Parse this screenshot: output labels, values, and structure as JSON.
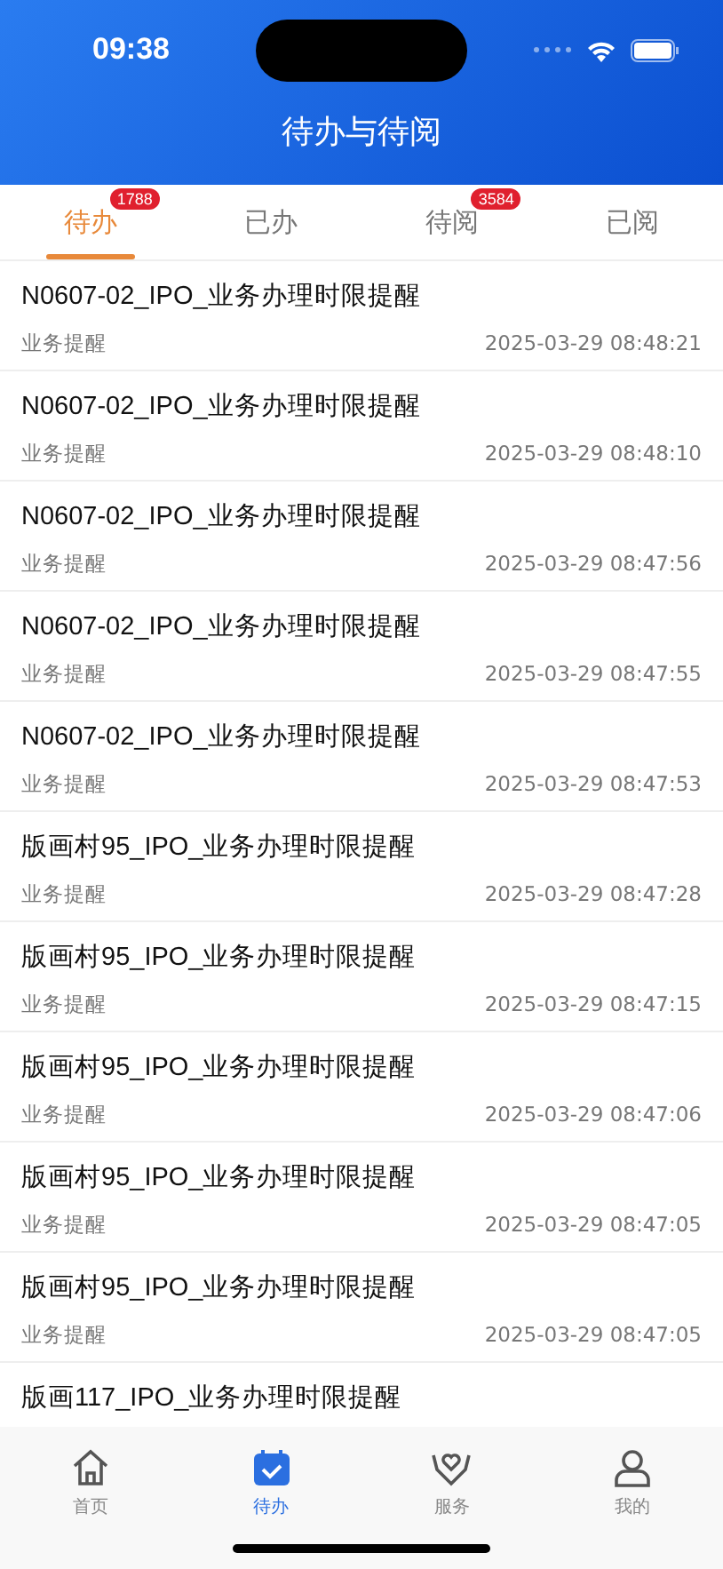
{
  "status_bar": {
    "time": "09:38"
  },
  "header": {
    "title": "待办与待阅"
  },
  "tabs": [
    {
      "label": "待办",
      "selected": true,
      "badge": "1788"
    },
    {
      "label": "已办",
      "selected": false
    },
    {
      "label": "待阅",
      "selected": false,
      "badge": "3584"
    },
    {
      "label": "已阅",
      "selected": false
    }
  ],
  "items": [
    {
      "title": "N0607-02_IPO_业务办理时限提醒",
      "type": "业务提醒",
      "time": "2025-03-29 08:48:21"
    },
    {
      "title": "N0607-02_IPO_业务办理时限提醒",
      "type": "业务提醒",
      "time": "2025-03-29 08:48:10"
    },
    {
      "title": "N0607-02_IPO_业务办理时限提醒",
      "type": "业务提醒",
      "time": "2025-03-29 08:47:56"
    },
    {
      "title": "N0607-02_IPO_业务办理时限提醒",
      "type": "业务提醒",
      "time": "2025-03-29 08:47:55"
    },
    {
      "title": "N0607-02_IPO_业务办理时限提醒",
      "type": "业务提醒",
      "time": "2025-03-29 08:47:53"
    },
    {
      "title": "版画村95_IPO_业务办理时限提醒",
      "type": "业务提醒",
      "time": "2025-03-29 08:47:28"
    },
    {
      "title": "版画村95_IPO_业务办理时限提醒",
      "type": "业务提醒",
      "time": "2025-03-29 08:47:15"
    },
    {
      "title": "版画村95_IPO_业务办理时限提醒",
      "type": "业务提醒",
      "time": "2025-03-29 08:47:06"
    },
    {
      "title": "版画村95_IPO_业务办理时限提醒",
      "type": "业务提醒",
      "time": "2025-03-29 08:47:05"
    },
    {
      "title": "版画村95_IPO_业务办理时限提醒",
      "type": "业务提醒",
      "time": "2025-03-29 08:47:05"
    },
    {
      "title": "版画117_IPO_业务办理时限提醒"
    }
  ],
  "tab_bar": [
    {
      "label": "首页",
      "kind": "home",
      "selected": false
    },
    {
      "label": "待办",
      "kind": "todo",
      "selected": true
    },
    {
      "label": "服务",
      "kind": "service",
      "selected": false
    },
    {
      "label": "我的",
      "kind": "profile",
      "selected": false
    }
  ]
}
